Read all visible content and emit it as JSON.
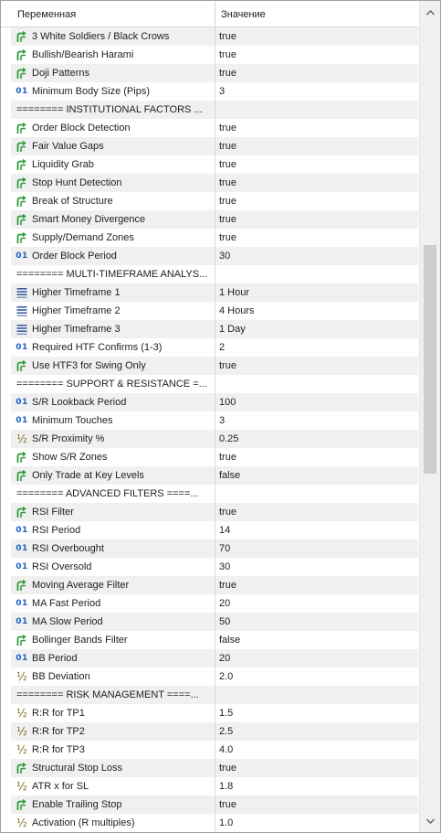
{
  "header": {
    "name_col": "Переменная",
    "value_col": "Значение"
  },
  "icons": {
    "bool": "bool-arrow-icon",
    "int": "integer-01-icon",
    "double": "fraction-icon",
    "enum": "enum-list-icon"
  },
  "rows": [
    {
      "type": "bool",
      "name": "3 White Soldiers / Black Crows",
      "value": "true"
    },
    {
      "type": "bool",
      "name": "Bullish/Bearish Harami",
      "value": "true"
    },
    {
      "type": "bool",
      "name": "Doji Patterns",
      "value": "true"
    },
    {
      "type": "int",
      "name": "Minimum Body Size (Pips)",
      "value": "3"
    },
    {
      "type": "sep",
      "name": "======== INSTITUTIONAL FACTORS ...",
      "value": ""
    },
    {
      "type": "bool",
      "name": "Order Block Detection",
      "value": "true"
    },
    {
      "type": "bool",
      "name": "Fair Value Gaps",
      "value": "true"
    },
    {
      "type": "bool",
      "name": "Liquidity Grab",
      "value": "true"
    },
    {
      "type": "bool",
      "name": "Stop Hunt Detection",
      "value": "true"
    },
    {
      "type": "bool",
      "name": "Break of Structure",
      "value": "true"
    },
    {
      "type": "bool",
      "name": "Smart Money Divergence",
      "value": "true"
    },
    {
      "type": "bool",
      "name": "Supply/Demand Zones",
      "value": "true"
    },
    {
      "type": "int",
      "name": "Order Block Period",
      "value": "30"
    },
    {
      "type": "sep",
      "name": "======== MULTI-TIMEFRAME ANALYS...",
      "value": ""
    },
    {
      "type": "enum",
      "name": "Higher Timeframe 1",
      "value": "1 Hour"
    },
    {
      "type": "enum",
      "name": "Higher Timeframe 2",
      "value": "4 Hours"
    },
    {
      "type": "enum",
      "name": "Higher Timeframe 3",
      "value": "1 Day"
    },
    {
      "type": "int",
      "name": "Required HTF Confirms (1-3)",
      "value": "2"
    },
    {
      "type": "bool",
      "name": "Use HTF3 for Swing Only",
      "value": "true"
    },
    {
      "type": "sep",
      "name": "======== SUPPORT & RESISTANCE =...",
      "value": ""
    },
    {
      "type": "int",
      "name": "S/R Lookback Period",
      "value": "100"
    },
    {
      "type": "int",
      "name": "Minimum Touches",
      "value": "3"
    },
    {
      "type": "double",
      "name": "S/R Proximity %",
      "value": "0.25"
    },
    {
      "type": "bool",
      "name": "Show S/R Zones",
      "value": "true"
    },
    {
      "type": "bool",
      "name": "Only Trade at Key Levels",
      "value": "false"
    },
    {
      "type": "sep",
      "name": "======== ADVANCED FILTERS ====...",
      "value": ""
    },
    {
      "type": "bool",
      "name": "RSI Filter",
      "value": "true"
    },
    {
      "type": "int",
      "name": "RSI Period",
      "value": "14"
    },
    {
      "type": "int",
      "name": "RSI Overbought",
      "value": "70"
    },
    {
      "type": "int",
      "name": "RSI Oversold",
      "value": "30"
    },
    {
      "type": "bool",
      "name": "Moving Average Filter",
      "value": "true"
    },
    {
      "type": "int",
      "name": "MA Fast Period",
      "value": "20"
    },
    {
      "type": "int",
      "name": "MA Slow Period",
      "value": "50"
    },
    {
      "type": "bool",
      "name": "Bollinger Bands Filter",
      "value": "false"
    },
    {
      "type": "int",
      "name": "BB Period",
      "value": "20"
    },
    {
      "type": "double",
      "name": "BB Deviation",
      "value": "2.0"
    },
    {
      "type": "sep",
      "name": "======== RISK MANAGEMENT ====...",
      "value": ""
    },
    {
      "type": "double",
      "name": "R:R for TP1",
      "value": "1.5"
    },
    {
      "type": "double",
      "name": "R:R for TP2",
      "value": "2.5"
    },
    {
      "type": "double",
      "name": "R:R for TP3",
      "value": "4.0"
    },
    {
      "type": "bool",
      "name": "Structural Stop Loss",
      "value": "true"
    },
    {
      "type": "double",
      "name": "ATR x for SL",
      "value": "1.8"
    },
    {
      "type": "bool",
      "name": "Enable Trailing Stop",
      "value": "true"
    },
    {
      "type": "double",
      "name": "Activation (R multiples)",
      "value": "1.0"
    }
  ],
  "scrollbar": {
    "up": "chevron-up-icon",
    "down": "chevron-down-icon"
  }
}
